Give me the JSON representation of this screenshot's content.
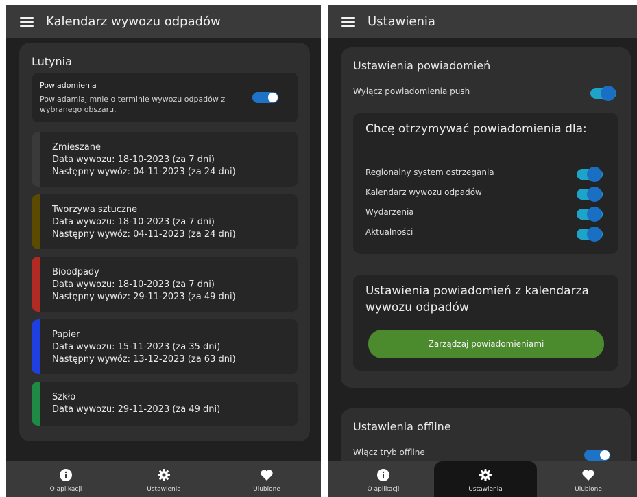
{
  "left": {
    "header": {
      "title": "Kalendarz wywozu odpadów"
    },
    "panel_title": "Lutynia",
    "notifications": {
      "title": "Powiadomienia",
      "description": "Powiadamiaj mnie o terminie wywozu odpadów z wybranego obszaru."
    },
    "waste": [
      {
        "name": "Zmieszane",
        "pickup": "Data wywozu: 18-10-2023 (za 7 dni)",
        "next": "Następny wywóz: 04-11-2023 (za 24 dni)",
        "color": "#3a3a3a"
      },
      {
        "name": "Tworzywa sztuczne",
        "pickup": "Data wywozu: 18-10-2023 (za 7 dni)",
        "next": "Następny wywóz: 04-11-2023 (za 24 dni)",
        "color": "#5c4a00"
      },
      {
        "name": "Bioodpady",
        "pickup": "Data wywozu: 18-10-2023 (za 7 dni)",
        "next": "Następny wywóz: 29-11-2023 (za 49 dni)",
        "color": "#b22a24"
      },
      {
        "name": "Papier",
        "pickup": "Data wywozu: 15-11-2023 (za 35 dni)",
        "next": "Następny wywóz: 13-12-2023 (za 63 dni)",
        "color": "#1f3fe0"
      },
      {
        "name": "Szkło",
        "pickup": "Data wywozu: 29-11-2023 (za 49 dni)",
        "next": "",
        "color": "#1e8a45"
      }
    ]
  },
  "right": {
    "header": {
      "title": "Ustawienia"
    },
    "notif_settings_title": "Ustawienia powiadomień",
    "push_off_label": "Wyłącz powiadomienia push",
    "receive_title": "Chcę otrzymywać powiadomienia dla:",
    "receive_items": [
      "Regionalny system ostrzegania",
      "Kalendarz wywozu odpadów",
      "Wydarzenia",
      "Aktualności"
    ],
    "calendar_settings_title": "Ustawienia powiadomień z kalendarza wywozu odpadów",
    "manage_button": "Zarządzaj powiadomieniami",
    "offline_title": "Ustawienia offline",
    "offline_label": "Włącz tryb offline"
  },
  "nav": {
    "about": "O aplikacji",
    "settings": "Ustawienia",
    "favorites": "Ulubione"
  },
  "colors": {
    "accent": "#1f73c6",
    "green": "#4c8a2e"
  }
}
